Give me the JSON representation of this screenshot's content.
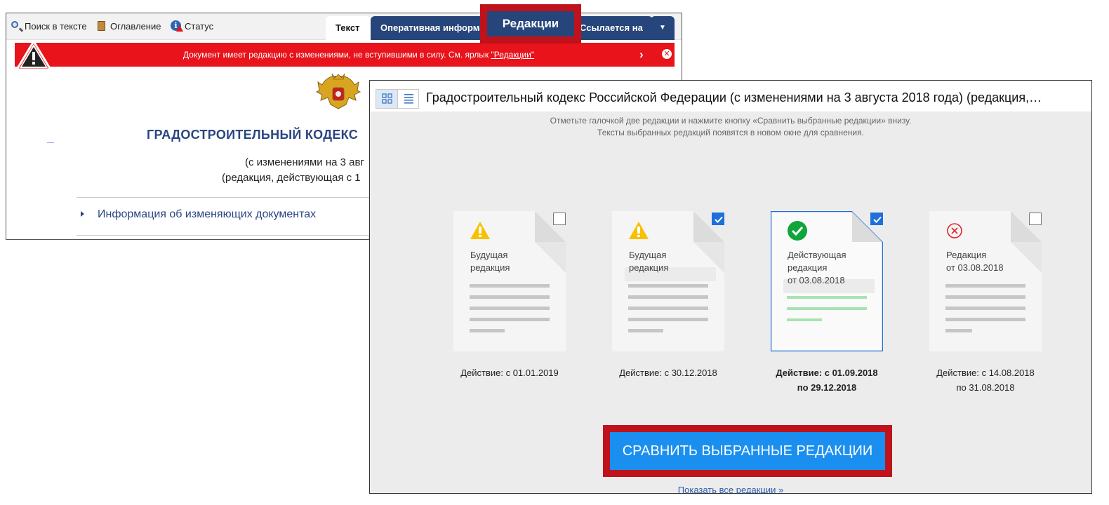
{
  "toolbar": {
    "search_label": "Поиск в тексте",
    "toc_label": "Оглавление",
    "status_label": "Статус"
  },
  "tabs": {
    "text": "Текст",
    "operative": "Оперативная информация",
    "editions": "Редакции",
    "refs": "Ссылается на",
    "more": "▼"
  },
  "alert": {
    "text": "Документ имеет редакцию с изменениями, не вступившими в силу. См. ярлык",
    "link": "\"Редакции\"",
    "next": "›",
    "close": "✕"
  },
  "document": {
    "title": "ГРАДОСТРОИТЕЛЬНЫЙ КОДЕКС",
    "subtitle1": "(с изменениями на 3 авг",
    "subtitle2": "(редакция, действующая с 1",
    "info_link": "Информация об изменяющих документах"
  },
  "editions_panel": {
    "title": "Градостроительный кодекс Российской Федерации (с изменениями на 3 августа 2018 года) (редакция,…",
    "hint1": "Отметьте галочкой две редакции и нажмите кнопку «Сравнить выбранные редакции» внизу.",
    "hint2": "Тексты выбранных редакций появятся в новом окне для сравнения.",
    "cards": [
      {
        "line1": "Будущая",
        "line2": "редакция",
        "line3": "",
        "status": "warning",
        "checked": false,
        "eff1": "Действие: с 01.01.2019",
        "eff2": ""
      },
      {
        "line1": "Будущая",
        "line2": "редакция",
        "line3": "",
        "status": "warning",
        "checked": true,
        "eff1": "Действие: с 30.12.2018",
        "eff2": ""
      },
      {
        "line1": "Действующая",
        "line2": "редакция",
        "line3": "от 03.08.2018",
        "status": "current",
        "checked": true,
        "eff1": "Действие: с 01.09.2018",
        "eff2": "по 29.12.2018"
      },
      {
        "line1": "Редакция",
        "line2": "от 03.08.2018",
        "line3": "",
        "status": "expired",
        "checked": false,
        "eff1": "Действие: с 14.08.2018",
        "eff2": "по 31.08.2018"
      }
    ],
    "compare_button": "СРАВНИТЬ ВЫБРАННЫЕ РЕДАКЦИИ",
    "show_all": "Показать все редакции »"
  },
  "colors": {
    "accent_blue": "#1a8ff0",
    "tab_navy": "#26457a",
    "alert_red": "#e8131b",
    "highlight_red": "#c0121a",
    "check_blue": "#1e6fd9",
    "current_green": "#0fa53a"
  }
}
